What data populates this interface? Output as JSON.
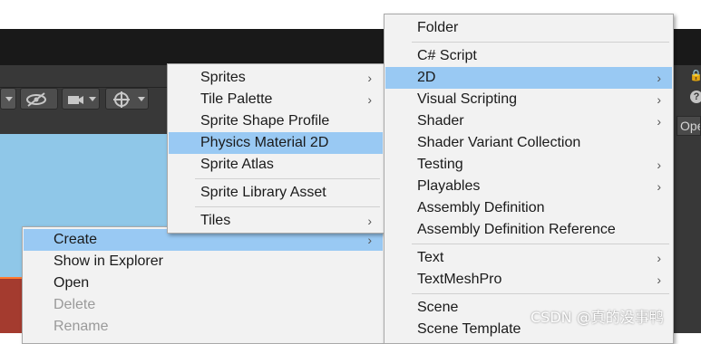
{
  "context_menu": {
    "items": [
      {
        "label": "Create",
        "has_submenu": true,
        "highlighted": true,
        "disabled": false
      },
      {
        "label": "Show in Explorer",
        "has_submenu": false,
        "highlighted": false,
        "disabled": false
      },
      {
        "label": "Open",
        "has_submenu": false,
        "highlighted": false,
        "disabled": false
      },
      {
        "label": "Delete",
        "has_submenu": false,
        "highlighted": false,
        "disabled": true
      },
      {
        "label": "Rename",
        "has_submenu": false,
        "highlighted": false,
        "disabled": true
      }
    ]
  },
  "create_menu": {
    "items": [
      {
        "label": "Folder"
      },
      {
        "label": "C# Script"
      },
      {
        "label": "2D",
        "submenu": true,
        "highlighted": true
      },
      {
        "label": "Visual Scripting",
        "submenu": true
      },
      {
        "label": "Shader",
        "submenu": true
      },
      {
        "label": "Shader Variant Collection"
      },
      {
        "label": "Testing",
        "submenu": true
      },
      {
        "label": "Playables",
        "submenu": true
      },
      {
        "label": "Assembly Definition"
      },
      {
        "label": "Assembly Definition Reference"
      },
      {
        "label": "Text",
        "submenu": true
      },
      {
        "label": "TextMeshPro",
        "submenu": true
      },
      {
        "label": "Scene"
      },
      {
        "label": "Scene Template"
      }
    ]
  },
  "twod_menu": {
    "items": [
      {
        "label": "Sprites",
        "submenu": true
      },
      {
        "label": "Tile Palette",
        "submenu": true
      },
      {
        "label": "Sprite Shape Profile"
      },
      {
        "label": "Physics Material 2D",
        "highlighted": true
      },
      {
        "label": "Sprite Atlas"
      },
      {
        "label": "Sprite Library Asset"
      },
      {
        "label": "Tiles",
        "submenu": true
      }
    ]
  },
  "editor": {
    "right_button_label": "Ope",
    "help_icon": "?",
    "lock_icon": "lock-icon"
  },
  "arrow_glyph": "›",
  "watermark": "CSDN @真的没事鸭",
  "colors": {
    "highlight": "#99c9f3",
    "menu_bg": "#f2f2f2",
    "editor_dark": "#383838",
    "scene_sky": "#8fc7e8"
  }
}
